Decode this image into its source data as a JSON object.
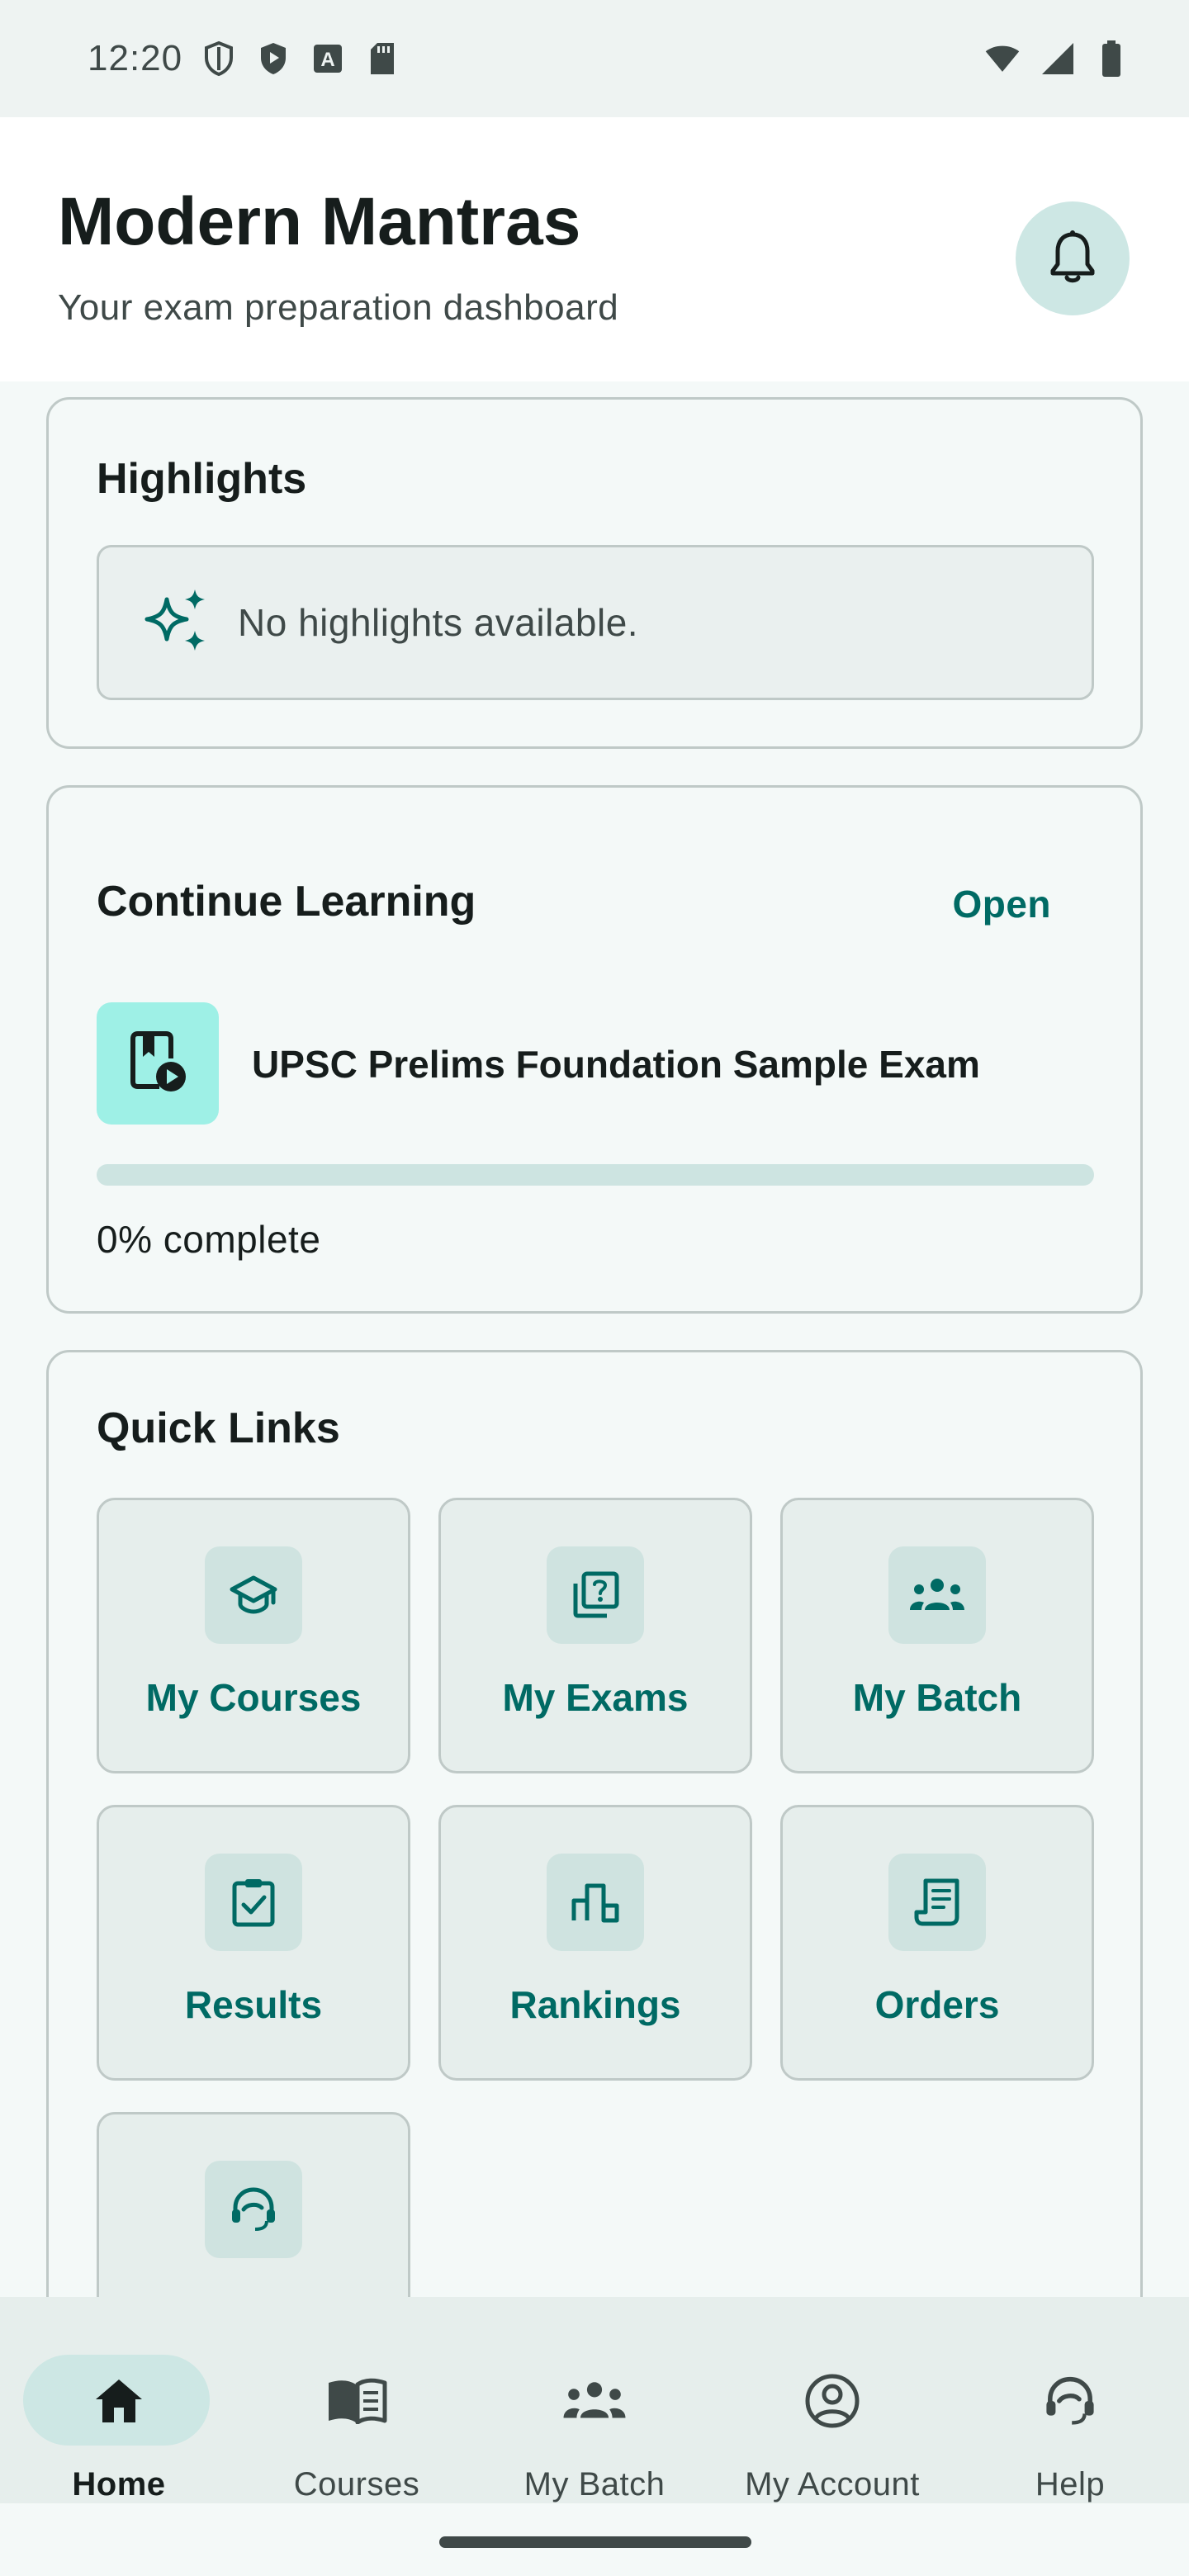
{
  "status_bar": {
    "time": "12:20",
    "icons": [
      "shield-outline-icon",
      "play-shield-icon",
      "font-a-icon",
      "sd-card-icon"
    ],
    "right_icons": [
      "wifi-icon",
      "signal-icon",
      "battery-icon"
    ]
  },
  "header": {
    "title": "Modern Mantras",
    "subtitle": "Your exam preparation dashboard",
    "notification_icon": "bell-icon"
  },
  "highlights": {
    "title": "Highlights",
    "empty_icon": "sparkles-icon",
    "empty_text": "No highlights available."
  },
  "continue_learning": {
    "title": "Continue Learning",
    "open_label": "Open",
    "course_icon": "book-play-icon",
    "course_name": "UPSC Prelims Foundation Sample Exam",
    "progress_fraction": 0,
    "progress_text": "0% complete"
  },
  "quick_links": {
    "title": "Quick Links",
    "items": [
      {
        "label": "My Courses",
        "icon": "graduation-cap-icon"
      },
      {
        "label": "My Exams",
        "icon": "quiz-icon"
      },
      {
        "label": "My Batch",
        "icon": "group-icon"
      },
      {
        "label": "Results",
        "icon": "clipboard-check-icon"
      },
      {
        "label": "Rankings",
        "icon": "leaderboard-icon"
      },
      {
        "label": "Orders",
        "icon": "receipt-icon"
      },
      {
        "label": "",
        "icon": "headset-icon"
      }
    ]
  },
  "bottom_nav": {
    "items": [
      {
        "label": "Home",
        "icon": "home-icon",
        "active": true
      },
      {
        "label": "Courses",
        "icon": "open-book-icon",
        "active": false
      },
      {
        "label": "My Batch",
        "icon": "group-icon",
        "active": false
      },
      {
        "label": "My Account",
        "icon": "account-circle-icon",
        "active": false
      },
      {
        "label": "Help",
        "icon": "headset-icon",
        "active": false
      }
    ]
  },
  "colors": {
    "accent": "#006a64",
    "surface": "#f4f9f8",
    "tile": "#e6eeec",
    "icon_container": "#cfe3e0",
    "active_pill": "#cde7e4",
    "thumb": "#9ef0e6",
    "outline": "#bfc9c7",
    "text": "#161d1c",
    "muted_text": "#3f4948"
  }
}
